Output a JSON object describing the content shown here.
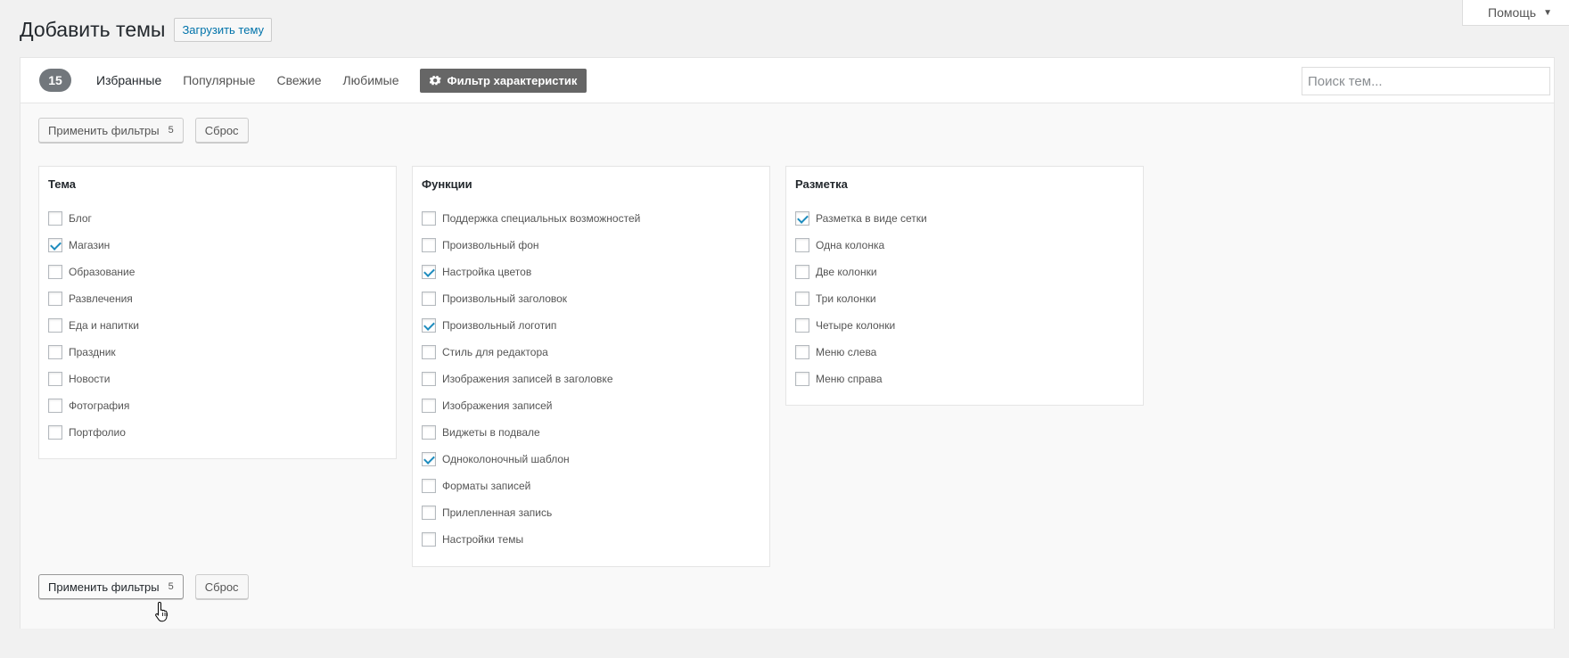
{
  "help": {
    "label": "Помощь",
    "arrow": "▼"
  },
  "header": {
    "title": "Добавить темы",
    "upload_label": "Загрузить тему"
  },
  "tabs": {
    "count": "15",
    "items": [
      "Избранные",
      "Популярные",
      "Свежие",
      "Любимые"
    ],
    "feature_filter_label": "Фильтр характеристик"
  },
  "search": {
    "placeholder": "Поиск тем..."
  },
  "actions": {
    "apply_label": "Применить фильтры",
    "apply_count": "5",
    "reset_label": "Сброс"
  },
  "groups": [
    {
      "title": "Тема",
      "options": [
        {
          "label": "Блог",
          "checked": false
        },
        {
          "label": "Магазин",
          "checked": true
        },
        {
          "label": "Образование",
          "checked": false
        },
        {
          "label": "Развлечения",
          "checked": false
        },
        {
          "label": "Еда и напитки",
          "checked": false
        },
        {
          "label": "Праздник",
          "checked": false
        },
        {
          "label": "Новости",
          "checked": false
        },
        {
          "label": "Фотография",
          "checked": false
        },
        {
          "label": "Портфолио",
          "checked": false
        }
      ]
    },
    {
      "title": "Функции",
      "options": [
        {
          "label": "Поддержка специальных возможностей",
          "checked": false
        },
        {
          "label": "Произвольный фон",
          "checked": false
        },
        {
          "label": "Настройка цветов",
          "checked": true
        },
        {
          "label": "Произвольный заголовок",
          "checked": false
        },
        {
          "label": "Произвольный логотип",
          "checked": true
        },
        {
          "label": "Стиль для редактора",
          "checked": false
        },
        {
          "label": "Изображения записей в заголовке",
          "checked": false
        },
        {
          "label": "Изображения записей",
          "checked": false
        },
        {
          "label": "Виджеты в подвале",
          "checked": false
        },
        {
          "label": "Одноколоночный шаблон",
          "checked": true
        },
        {
          "label": "Форматы записей",
          "checked": false
        },
        {
          "label": "Прилепленная запись",
          "checked": false
        },
        {
          "label": "Настройки темы",
          "checked": false
        }
      ]
    },
    {
      "title": "Разметка",
      "options": [
        {
          "label": "Разметка в виде сетки",
          "checked": true
        },
        {
          "label": "Одна колонка",
          "checked": false
        },
        {
          "label": "Две колонки",
          "checked": false
        },
        {
          "label": "Три колонки",
          "checked": false
        },
        {
          "label": "Четыре колонки",
          "checked": false
        },
        {
          "label": "Меню слева",
          "checked": false
        },
        {
          "label": "Меню справа",
          "checked": false
        }
      ]
    }
  ],
  "colors": {
    "accent": "#0073aa",
    "check": "#1e8cbe",
    "count_bg": "#72777c",
    "feature_btn_bg": "#666666"
  }
}
